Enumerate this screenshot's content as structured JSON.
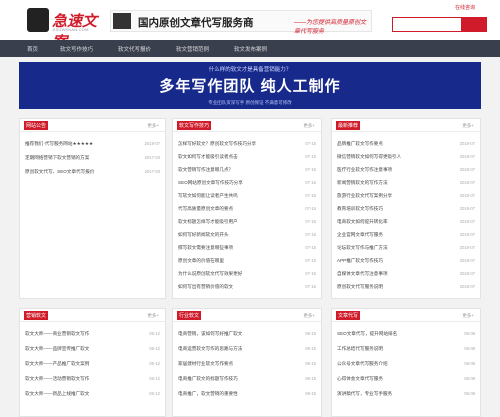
{
  "header": {
    "logo_text": "急速文案",
    "logo_sub": "JISUWENAN.COM",
    "slogan_main": "国内原创文章代写服务商",
    "slogan_sub": "——为您提供高质量原创文章代写服务",
    "top_link": "在线咨询"
  },
  "search": {
    "placeholder": "",
    "button_label": ""
  },
  "nav": {
    "items": [
      "首页",
      "软文写作技巧",
      "软文代写报价",
      "软文营销范例",
      "软文发布案例"
    ]
  },
  "banner": {
    "top": "什么样的软文才是具备营销能力？",
    "main": "多年写作团队  纯人工制作",
    "bottom": "专业团队资深写手 原创保证 不满意可修改"
  },
  "panels": [
    {
      "title": "网站公告",
      "more": "更多+",
      "rows": [
        {
          "text": "推荐我们·代写服务网站★★★★★",
          "date": "2018-07"
        },
        {
          "text": "定期网络营销下软文营销的方案",
          "date": "2017-03"
        },
        {
          "text": "原创软文代写、SEO文章代写报价",
          "date": "2017-03"
        }
      ]
    },
    {
      "title": "软文写作技巧",
      "more": "更多+",
      "rows": [
        {
          "text": "怎样写好软文？原创软文写作技巧分享",
          "date": "07-16"
        },
        {
          "text": "软文如何写才能吸引读者点击",
          "date": "07-16"
        },
        {
          "text": "软文营销写作注意哪几点？",
          "date": "07-16"
        },
        {
          "text": "SEO网站原创文章写作技巧分享",
          "date": "07-16"
        },
        {
          "text": "写软文如何能让读者产生共鸣",
          "date": "07-16"
        },
        {
          "text": "代写高质量原创文章的要点",
          "date": "07-16"
        },
        {
          "text": "软文标题怎样写才能吸引用户",
          "date": "07-16"
        },
        {
          "text": "如何写好新闻软文的开头",
          "date": "07-16"
        },
        {
          "text": "撰写软文需要注意哪些事项",
          "date": "07-16"
        },
        {
          "text": "原创文章的价值在哪里",
          "date": "07-16"
        },
        {
          "text": "为什么说原创软文代写效果更好",
          "date": "07-16"
        },
        {
          "text": "如何写出有营销价值的软文",
          "date": "07-16"
        }
      ]
    },
    {
      "title": "最新推荐",
      "more": "更多+",
      "rows": [
        {
          "text": "品牌推广软文写作要点",
          "date": "2018-07"
        },
        {
          "text": "微信营销软文如何写得更吸引人",
          "date": "2018-07"
        },
        {
          "text": "医疗行业软文写作注意事项",
          "date": "2018-07"
        },
        {
          "text": "新闻营销软文的写作方法",
          "date": "2018-07"
        },
        {
          "text": "旅游行业软文代写案例分享",
          "date": "2018-07"
        },
        {
          "text": "教育培训软文写作技巧",
          "date": "2018-07"
        },
        {
          "text": "电商软文如何提升转化率",
          "date": "2018-07"
        },
        {
          "text": "企业官网文章代写服务",
          "date": "2018-07"
        },
        {
          "text": "论坛软文写作与推广方法",
          "date": "2018-07"
        },
        {
          "text": "APP推广软文写作技巧",
          "date": "2018-07"
        },
        {
          "text": "自媒体文章代写注意事项",
          "date": "2018-07"
        },
        {
          "text": "原创软文代写服务说明",
          "date": "2018-07"
        }
      ]
    },
    {
      "title": "营销软文",
      "more": "更多+",
      "rows": [
        {
          "text": "软文大师——商业营销软文写作",
          "date": "06-12"
        },
        {
          "text": "软文大师——品牌宣传推广软文",
          "date": "06-12"
        },
        {
          "text": "软文大师——产品推广软文案例",
          "date": "06-12"
        },
        {
          "text": "软文大师——活动营销软文写作",
          "date": "06-12"
        },
        {
          "text": "软文大师——新品上线推广软文",
          "date": "06-12"
        }
      ]
    },
    {
      "title": "行业软文",
      "more": "更多+",
      "rows": [
        {
          "text": "电商营销，该如何写好推广软文",
          "date": "06-15"
        },
        {
          "text": "电商运营软文写作的思路与方法",
          "date": "06-15"
        },
        {
          "text": "家居建材行业软文写作要点",
          "date": "06-15"
        },
        {
          "text": "电商推广软文的标题写作技巧",
          "date": "06-15"
        },
        {
          "text": "电商推广，软文营销的重要性",
          "date": "06-15"
        }
      ]
    },
    {
      "title": "文章代写",
      "more": "更多+",
      "rows": [
        {
          "text": "SEO文章代写，提升网站排名",
          "date": "06-08"
        },
        {
          "text": "工作总结代写服务说明",
          "date": "06-08"
        },
        {
          "text": "公众号文章代写服务介绍",
          "date": "06-08"
        },
        {
          "text": "心得体会文章代写服务",
          "date": "06-08"
        },
        {
          "text": "演讲稿代写，专业写手服务",
          "date": "06-08"
        }
      ]
    }
  ],
  "colors": {
    "accent": "#d01c2a",
    "nav": "#3a3f4d",
    "banner": "#172a8c"
  }
}
